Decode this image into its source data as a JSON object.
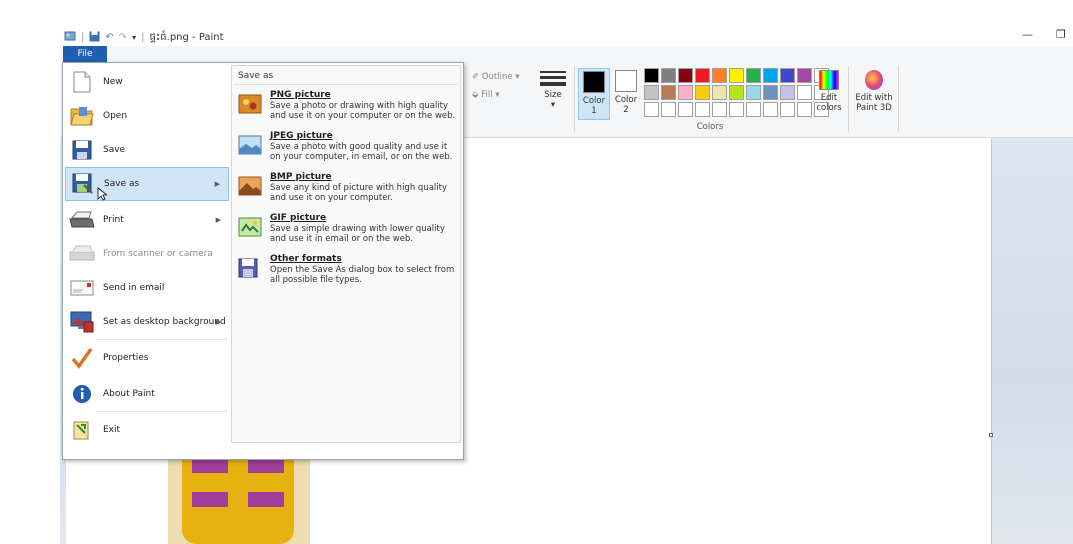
{
  "window": {
    "title": "ផ្ទះធំ.png - Paint",
    "minimize": "—",
    "restore": "❐"
  },
  "ribbon": {
    "file_tab": "File",
    "outline_label": "Outline",
    "fill_label": "Fill",
    "size_label": "Size",
    "color1_label": "Color 1",
    "color2_label": "Color 2",
    "colors_group_label": "Colors",
    "edit_colors_label": "Edit colors",
    "edit_3d_label": "Edit with Paint 3D",
    "color1_value": "#000000",
    "color2_value": "#ffffff",
    "palette": [
      "#000000",
      "#7f7f7f",
      "#880015",
      "#ed1c24",
      "#ff7f27",
      "#fff200",
      "#22b14c",
      "#00a2e8",
      "#3f48cc",
      "#a349a4",
      "#ffffff",
      "#c3c3c3",
      "#b97a57",
      "#ffaec9",
      "#ffc90e",
      "#efe4b0",
      "#b5e61d",
      "#99d9ea",
      "#7092be",
      "#c8bfe7",
      "#ffffff",
      "#ffffff",
      "#ffffff",
      "#ffffff",
      "#ffffff",
      "#ffffff",
      "#ffffff",
      "#ffffff",
      "#ffffff",
      "#ffffff",
      "#ffffff",
      "#ffffff",
      "#ffffff"
    ]
  },
  "file_menu": {
    "items": [
      {
        "label": "New",
        "icon": "new-document-icon",
        "enabled": true,
        "submenu": false
      },
      {
        "label": "Open",
        "icon": "open-folder-icon",
        "enabled": true,
        "submenu": false
      },
      {
        "label": "Save",
        "icon": "save-icon",
        "enabled": true,
        "submenu": false
      },
      {
        "label": "Save as",
        "icon": "save-as-icon",
        "enabled": true,
        "submenu": true,
        "selected": true
      },
      {
        "label": "Print",
        "icon": "printer-icon",
        "enabled": true,
        "submenu": true
      },
      {
        "label": "From scanner or camera",
        "icon": "scanner-icon",
        "enabled": false,
        "submenu": false
      },
      {
        "label": "Send in email",
        "icon": "email-icon",
        "enabled": true,
        "submenu": false
      },
      {
        "label": "Set as desktop background",
        "icon": "desktop-background-icon",
        "enabled": true,
        "submenu": true
      },
      {
        "label": "Properties",
        "icon": "checkmark-icon",
        "enabled": true,
        "submenu": false
      },
      {
        "label": "About Paint",
        "icon": "info-icon",
        "enabled": true,
        "submenu": false
      },
      {
        "label": "Exit",
        "icon": "exit-icon",
        "enabled": true,
        "submenu": false
      }
    ]
  },
  "save_as_menu": {
    "title": "Save as",
    "options": [
      {
        "title": "PNG picture",
        "description": "Save a photo or drawing with high quality and use it on your computer or on the web."
      },
      {
        "title": "JPEG picture",
        "description": "Save a photo with good quality and use it on your computer, in email, or on the web."
      },
      {
        "title": "BMP picture",
        "description": "Save any kind of picture with high quality and use it on your computer."
      },
      {
        "title": "GIF picture",
        "description": "Save a simple drawing with lower quality and use it in email or on the web."
      },
      {
        "title": "Other formats",
        "description": "Open the Save As dialog box to select from all possible file types."
      }
    ]
  }
}
